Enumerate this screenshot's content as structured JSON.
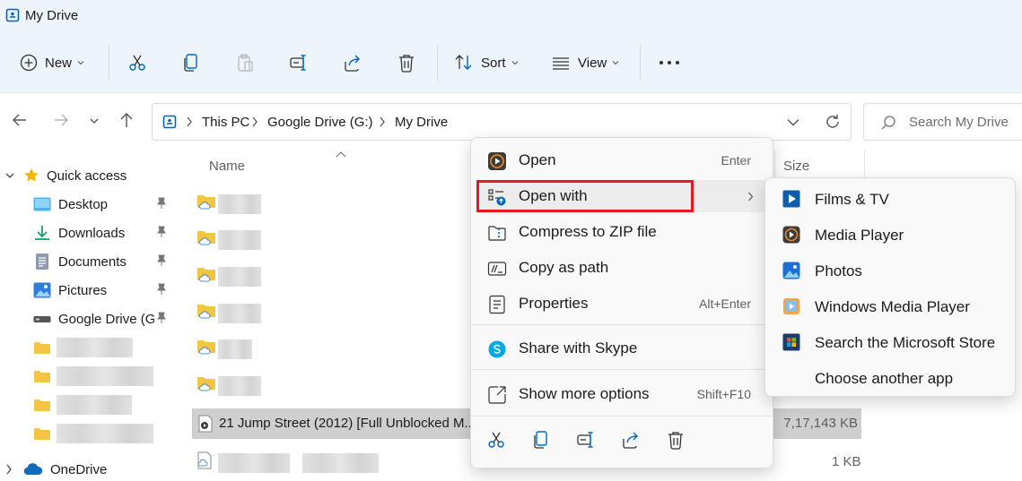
{
  "window": {
    "title": "My Drive"
  },
  "toolbar": {
    "new_label": "New",
    "sort_label": "Sort",
    "view_label": "View"
  },
  "address": {
    "crumbs": [
      "This PC",
      "Google Drive (G:)",
      "My Drive"
    ]
  },
  "search": {
    "placeholder": "Search My Drive"
  },
  "sidebar": {
    "quick_access": "Quick access",
    "items": [
      "Desktop",
      "Downloads",
      "Documents",
      "Pictures",
      "Google Drive (G:)"
    ],
    "onedrive": "OneDrive"
  },
  "columns": {
    "name": "Name",
    "size": "Size"
  },
  "selected_file": {
    "name": "21 Jump Street (2012) [Full Unblocked M...",
    "size": "7,17,143 KB"
  },
  "last_file": {
    "size": "1 KB"
  },
  "context_menu": {
    "open": {
      "label": "Open",
      "shortcut": "Enter"
    },
    "open_with": {
      "label": "Open with"
    },
    "compress": {
      "label": "Compress to ZIP file"
    },
    "copy_path": {
      "label": "Copy as path"
    },
    "properties": {
      "label": "Properties",
      "shortcut": "Alt+Enter"
    },
    "share_skype": {
      "label": "Share with Skype"
    },
    "more_options": {
      "label": "Show more options",
      "shortcut": "Shift+F10"
    }
  },
  "submenu": {
    "items": [
      "Films & TV",
      "Media Player",
      "Photos",
      "Windows Media Player",
      "Search the Microsoft Store",
      "Choose another app"
    ]
  },
  "colors": {
    "accent": "#0067c0",
    "highlight_border": "#e01b24",
    "folder": "#f4c541"
  }
}
